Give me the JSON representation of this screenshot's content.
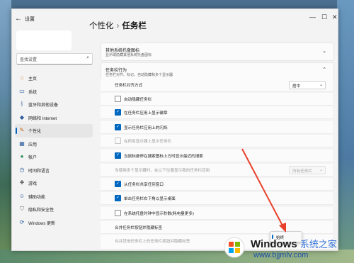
{
  "window": {
    "title": "设置",
    "back_icon": "back-arrow-icon",
    "controls": {
      "minimize": "—",
      "maximize": "☐",
      "close": "✕"
    }
  },
  "search": {
    "placeholder": "查找设置",
    "icon": "search-icon"
  },
  "sidebar": {
    "items": [
      {
        "label": "主页",
        "icon": "home-icon",
        "active": false
      },
      {
        "label": "系统",
        "icon": "system-icon",
        "active": false
      },
      {
        "label": "蓝牙和其他设备",
        "icon": "bluetooth-icon",
        "active": false
      },
      {
        "label": "网络和 Internet",
        "icon": "network-icon",
        "active": false
      },
      {
        "label": "个性化",
        "icon": "brush-icon",
        "active": true
      },
      {
        "label": "应用",
        "icon": "apps-icon",
        "active": false
      },
      {
        "label": "帐户",
        "icon": "account-icon",
        "active": false
      },
      {
        "label": "时间和语言",
        "icon": "clock-icon",
        "active": false
      },
      {
        "label": "游戏",
        "icon": "gamepad-icon",
        "active": false
      },
      {
        "label": "辅助功能",
        "icon": "accessibility-icon",
        "active": false
      },
      {
        "label": "隐私和安全性",
        "icon": "shield-icon",
        "active": false
      },
      {
        "label": "Windows 更新",
        "icon": "update-icon",
        "active": false
      }
    ]
  },
  "breadcrumb": {
    "parent": "个性化",
    "separator": "›",
    "current": "任务栏"
  },
  "sections": {
    "other_tray": {
      "title": "其他系统托盘图标",
      "subtitle": "显示或隐藏其他系统托盘图标"
    },
    "behaviors": {
      "title": "任务栏行为",
      "subtitle": "任务栏对齐、标记、自动隐藏和多个显示器"
    }
  },
  "rows": {
    "alignment": {
      "label": "任务栏对齐方式",
      "value": "居中"
    },
    "auto_hide": {
      "label": "自动隐藏任务栏",
      "checked": false
    },
    "badges": {
      "label": "在任务栏应用上显示徽章",
      "checked": true
    },
    "flashing": {
      "label": "显示任务栏应用上的闪烁",
      "checked": true
    },
    "all_displays": {
      "label": "在所有显示器上显示任务栏",
      "checked": false,
      "disabled": true
    },
    "search_hover": {
      "label": "当鼠标悬停在搜索图标上方时显示最近的搜索",
      "checked": true
    },
    "multi_display": {
      "label": "当使用多个显示器时，在以下位置显示我的任务栏应用",
      "value": "所有任务栏",
      "disabled": true
    },
    "share_window": {
      "label": "从任务栏共享任何窗口",
      "checked": true
    },
    "far_corner": {
      "label": "单击任务栏右下角以显示桌面",
      "checked": true
    },
    "seconds": {
      "label": "在系统托盘时钟中显示秒数(耗电量更多)",
      "checked": false
    },
    "combine": {
      "label": "合并任务栏按钮并隐藏标签",
      "value": "始终"
    },
    "combine_other": {
      "label": "合并其他任务栏上的任务栏按钮并隐藏标签"
    }
  },
  "popup": {
    "option": "始终"
  },
  "watermark": {
    "brand": "Windows",
    "brand_cn": "系统之家",
    "url": "www.bjjmlv.com"
  },
  "colors": {
    "accent": "#0067c0",
    "annotation_arrow": "#e8412b"
  }
}
